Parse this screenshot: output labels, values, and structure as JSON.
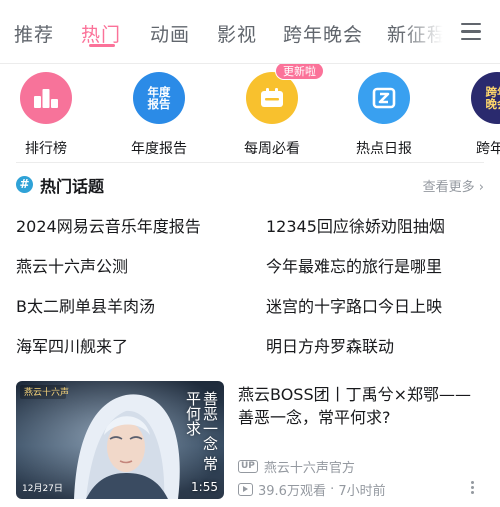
{
  "tabs": [
    {
      "label": "推荐",
      "active": false
    },
    {
      "label": "热门",
      "active": true
    },
    {
      "label": "动画",
      "active": false
    },
    {
      "label": "影视",
      "active": false
    },
    {
      "label": "跨年晚会",
      "active": false
    },
    {
      "label": "新征程",
      "active": false
    }
  ],
  "accent_color": "#fb7299",
  "quick_entries": [
    {
      "label": "排行榜",
      "icon": "ranking-icon",
      "color": "#f7739a"
    },
    {
      "label": "年度报告",
      "icon": "annual-report-icon",
      "icon_text": [
        "年度",
        "报告"
      ],
      "color": "#2b8be7"
    },
    {
      "label": "每周必看",
      "icon": "weekly-must-watch-icon",
      "color": "#f8c12e",
      "badge": "更新啦"
    },
    {
      "label": "热点日报",
      "icon": "hot-daily-icon",
      "color": "#39a0f0"
    },
    {
      "label": "跨年晚",
      "icon": "new-year-gala-icon",
      "icon_text": [
        "跨年",
        "晚会"
      ],
      "color": "#2a2a6e"
    }
  ],
  "hot_topics": {
    "title": "热门话题",
    "more": "查看更多",
    "items": [
      "2024网易云音乐年度报告",
      "12345回应徐娇劝阻抽烟",
      "燕云十六声公测",
      "今年最难忘的旅行是哪里",
      "B太二刷单县羊肉汤",
      "迷宫的十字路口今日上映",
      "海军四川舰来了",
      "明日方舟罗森联动"
    ]
  },
  "video": {
    "title": "燕云BOSS团丨丁禹兮×郑鄂——善恶一念，常平何求?",
    "thumb_text": "善恶一念 常平何求",
    "thumb_date": "12月27日",
    "thumb_logo": "燕云十六声",
    "duration": "1:55",
    "up_tag": "UP",
    "up_name": "燕云十六声官方",
    "views": "39.6万观看",
    "time": "7小时前"
  }
}
